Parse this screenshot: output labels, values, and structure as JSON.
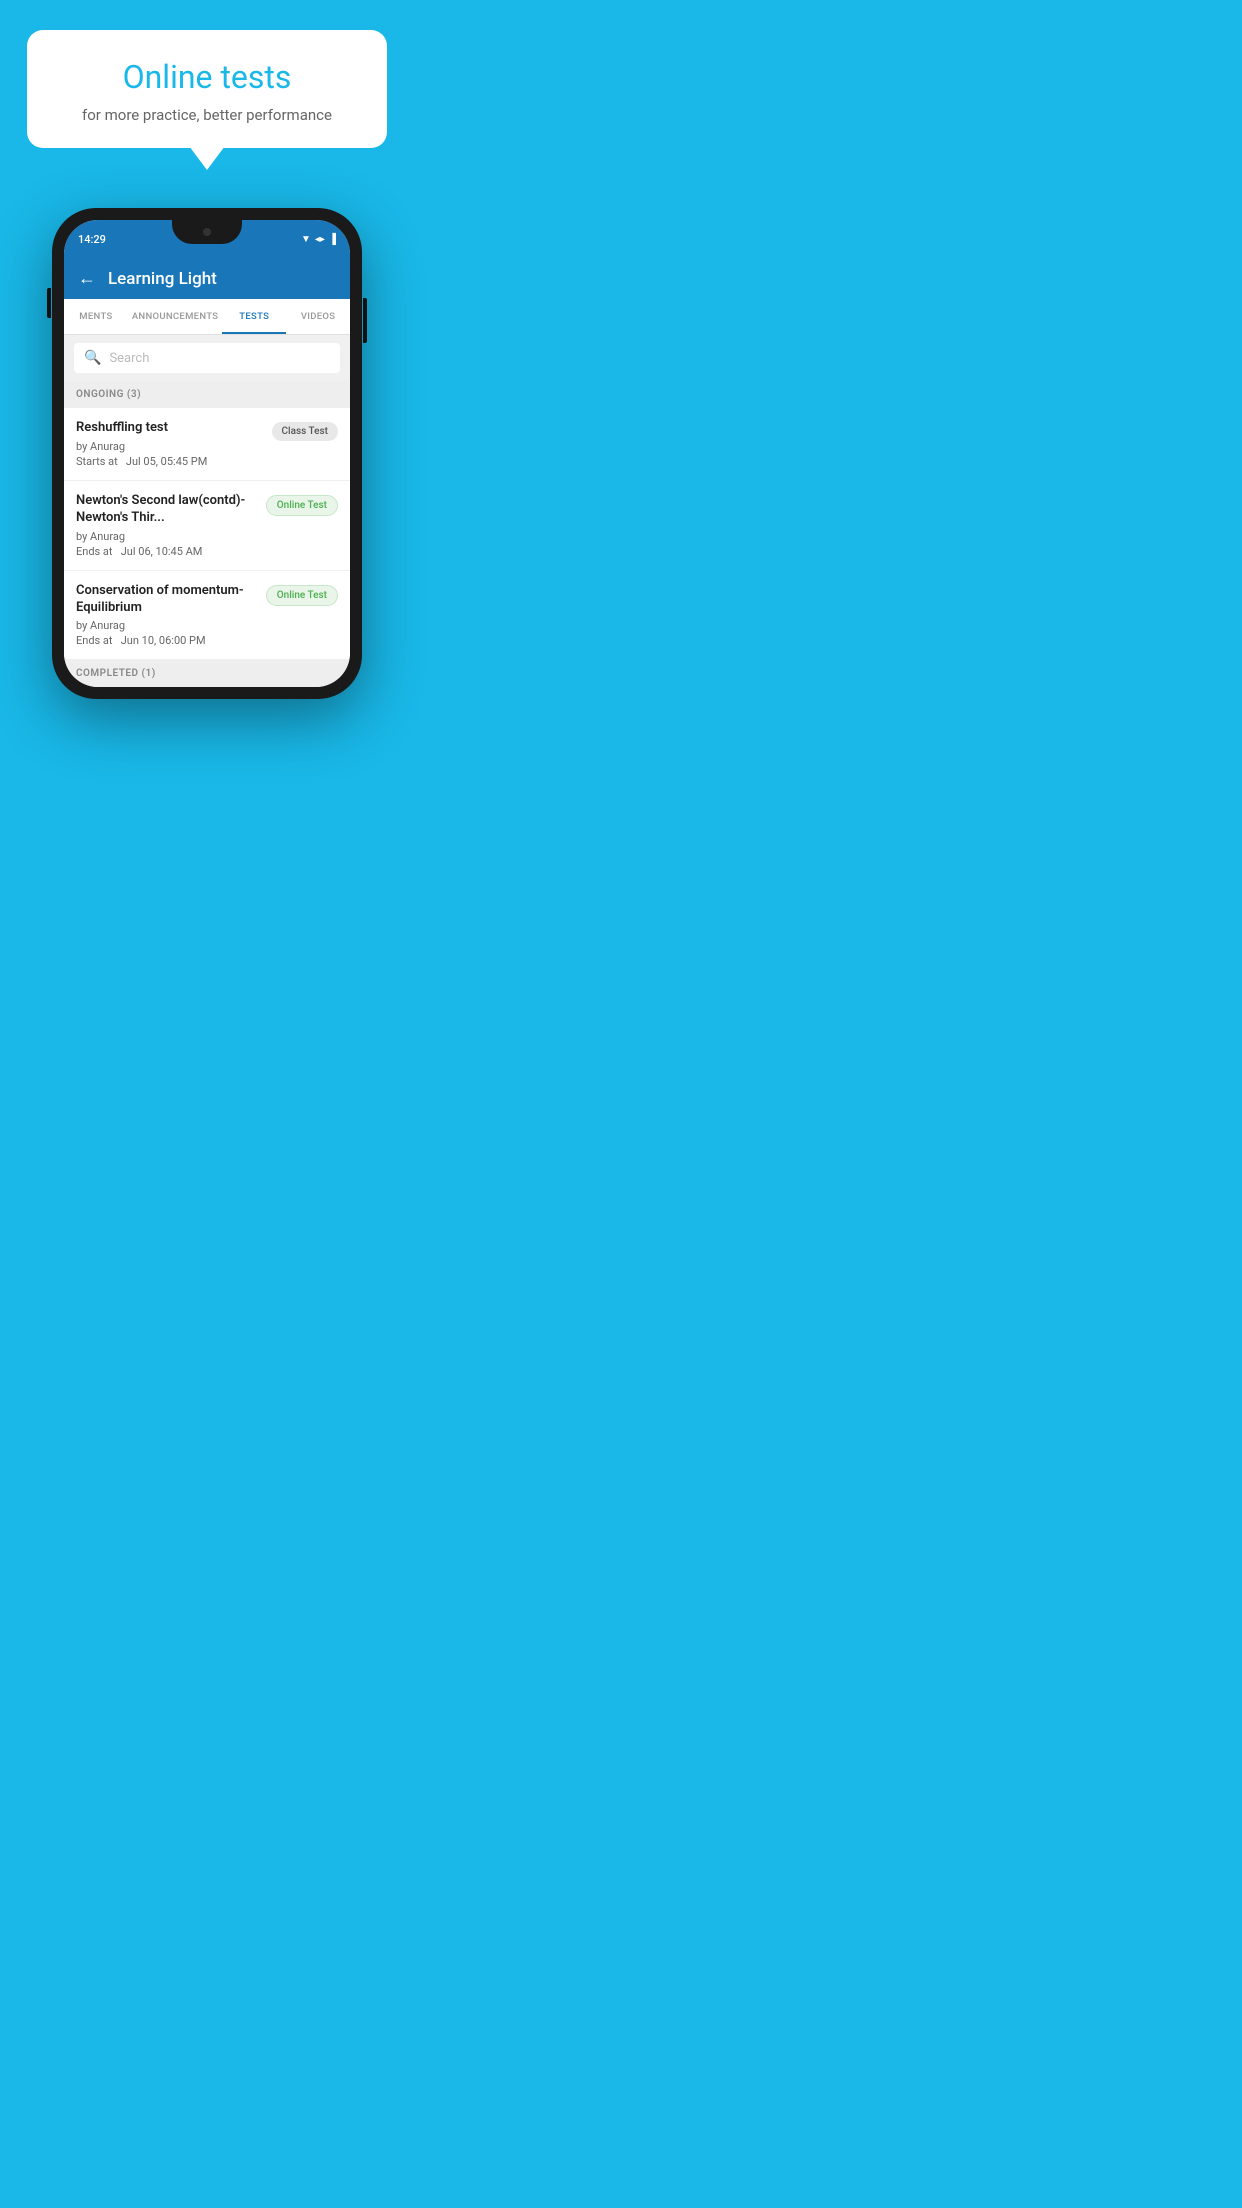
{
  "background_color": "#19B8E8",
  "bubble": {
    "title": "Online tests",
    "subtitle": "for more practice, better performance"
  },
  "phone": {
    "status_bar": {
      "time": "14:29",
      "icons": [
        "wifi",
        "signal",
        "battery"
      ]
    },
    "header": {
      "title": "Learning Light",
      "back_label": "←"
    },
    "tabs": [
      {
        "label": "MENTS",
        "active": false
      },
      {
        "label": "ANNOUNCEMENTS",
        "active": false
      },
      {
        "label": "TESTS",
        "active": true
      },
      {
        "label": "VIDEOS",
        "active": false
      }
    ],
    "search": {
      "placeholder": "Search"
    },
    "section_ongoing": {
      "label": "ONGOING (3)"
    },
    "tests": [
      {
        "name": "Reshuffling test",
        "by": "by Anurag",
        "date_label": "Starts at",
        "date": "Jul 05, 05:45 PM",
        "badge": "Class Test",
        "badge_type": "class"
      },
      {
        "name": "Newton's Second law(contd)-Newton's Thir...",
        "by": "by Anurag",
        "date_label": "Ends at",
        "date": "Jul 06, 10:45 AM",
        "badge": "Online Test",
        "badge_type": "online"
      },
      {
        "name": "Conservation of momentum-Equilibrium",
        "by": "by Anurag",
        "date_label": "Ends at",
        "date": "Jun 10, 06:00 PM",
        "badge": "Online Test",
        "badge_type": "online"
      }
    ],
    "section_completed": {
      "label": "COMPLETED (1)"
    }
  }
}
